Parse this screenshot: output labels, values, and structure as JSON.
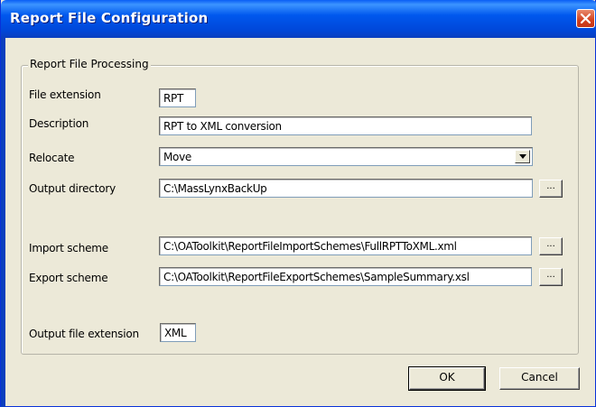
{
  "window": {
    "title": "Report File Configuration"
  },
  "group": {
    "label": "Report File Processing"
  },
  "fields": {
    "file_extension": {
      "label": "File extension",
      "value": "RPT"
    },
    "description": {
      "label": "Description",
      "value": "RPT to XML conversion"
    },
    "relocate": {
      "label": "Relocate",
      "value": "Move"
    },
    "output_directory": {
      "label": "Output directory",
      "value": "C:\\MassLynxBackUp"
    },
    "import_scheme": {
      "label": "Import scheme",
      "value": "C:\\OAToolkit\\ReportFileImportSchemes\\FullRPTToXML.xml"
    },
    "export_scheme": {
      "label": "Export scheme",
      "value": "C:\\OAToolkit\\ReportFileExportSchemes\\SampleSummary.xsl"
    },
    "output_file_extension": {
      "label": "Output file extension",
      "value": "XML"
    }
  },
  "buttons": {
    "browse": "...",
    "ok": "OK",
    "cancel": "Cancel"
  },
  "colors": {
    "titlebar": "#0058ee",
    "dialog_background": "#ece9d8",
    "close_button": "#d3401e"
  }
}
